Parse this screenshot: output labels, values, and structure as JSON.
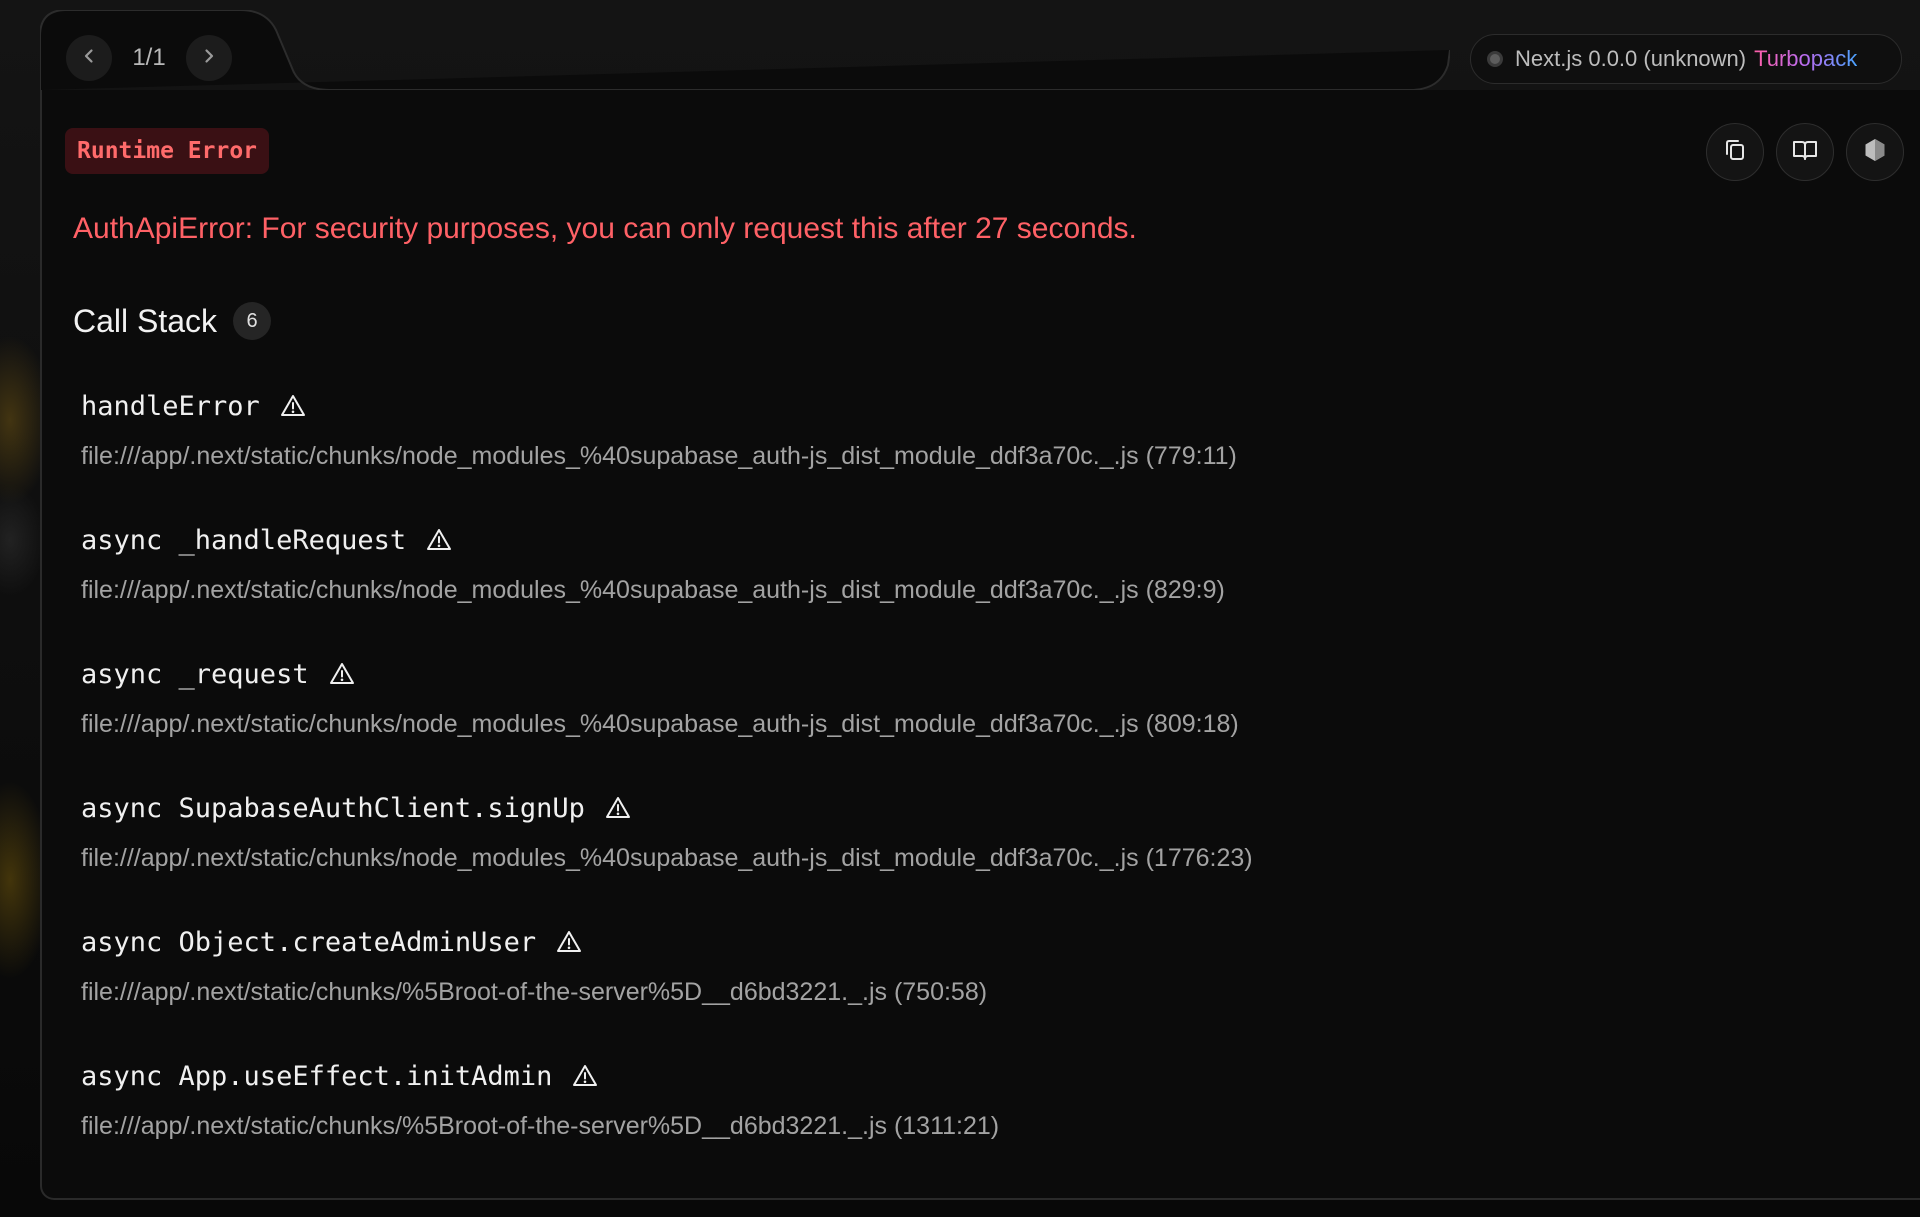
{
  "nav": {
    "page_count": "1/1",
    "prev_icon": "chevron-left-icon",
    "next_icon": "chevron-right-icon"
  },
  "version": {
    "label": "Next.js 0.0.0 (unknown)",
    "bundler": "Turbopack"
  },
  "error": {
    "type_label": "Runtime Error",
    "message": "AuthApiError: For security purposes, you can only request this after 27 seconds."
  },
  "toolbar": {
    "icons": [
      "copy-icon",
      "docs-book-icon",
      "nodejs-icon"
    ]
  },
  "call_stack": {
    "title": "Call Stack",
    "count": "6",
    "frames": [
      {
        "name": "handleError",
        "file": "file:///app/.next/static/chunks/node_modules_%40supabase_auth-js_dist_module_ddf3a70c._.js (779:11)"
      },
      {
        "name": "async _handleRequest",
        "file": "file:///app/.next/static/chunks/node_modules_%40supabase_auth-js_dist_module_ddf3a70c._.js (829:9)"
      },
      {
        "name": "async _request",
        "file": "file:///app/.next/static/chunks/node_modules_%40supabase_auth-js_dist_module_ddf3a70c._.js (809:18)"
      },
      {
        "name": "async SupabaseAuthClient.signUp",
        "file": "file:///app/.next/static/chunks/node_modules_%40supabase_auth-js_dist_module_ddf3a70c._.js (1776:23)"
      },
      {
        "name": "async Object.createAdminUser",
        "file": "file:///app/.next/static/chunks/%5Broot-of-the-server%5D__d6bd3221._.js (750:58)"
      },
      {
        "name": "async App.useEffect.initAdmin",
        "file": "file:///app/.next/static/chunks/%5Broot-of-the-server%5D__d6bd3221._.js (1311:21)"
      }
    ]
  },
  "colors": {
    "error_text": "#ff6166",
    "badge_bg": "#3a1014",
    "panel_bg": "#0b0b0b"
  }
}
